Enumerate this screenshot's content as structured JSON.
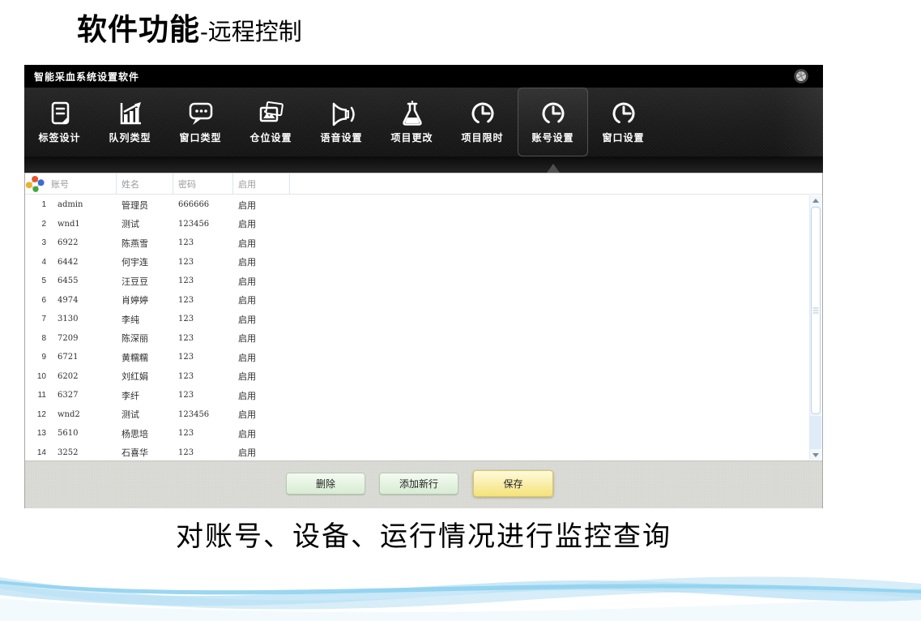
{
  "slide": {
    "title_main": "软件功能",
    "title_sub": "-远程控制",
    "caption": "对账号、设备、运行情况进行监控查询"
  },
  "window": {
    "title": "智能采血系统设置软件",
    "titlebar_icon": "shutter-gear-icon"
  },
  "toolbar": {
    "items": [
      {
        "id": "label-design",
        "label": "标签设计",
        "icon": "label-design-icon",
        "selected": false
      },
      {
        "id": "queue-type",
        "label": "队列类型",
        "icon": "queue-chart-icon",
        "selected": false
      },
      {
        "id": "window-type",
        "label": "窗口类型",
        "icon": "speech-bubble-icon",
        "selected": false
      },
      {
        "id": "bin-setting",
        "label": "仓位设置",
        "icon": "photos-icon",
        "selected": false
      },
      {
        "id": "voice-setting",
        "label": "语音设置",
        "icon": "speaker-icon",
        "selected": false
      },
      {
        "id": "project-change",
        "label": "项目更改",
        "icon": "flask-icon",
        "selected": false
      },
      {
        "id": "project-time-limit",
        "label": "项目限时",
        "icon": "clock-icon",
        "selected": false
      },
      {
        "id": "account-setting",
        "label": "账号设置",
        "icon": "clock-icon",
        "selected": true
      },
      {
        "id": "window-setting",
        "label": "窗口设置",
        "icon": "clock-icon",
        "selected": false
      }
    ]
  },
  "table": {
    "corner_icon": "molecule-users-icon",
    "columns": [
      "账号",
      "姓名",
      "密码",
      "启用"
    ],
    "rows": [
      {
        "num": "1",
        "account": "admin",
        "name": "管理员",
        "password": "666666",
        "enabled": "启用"
      },
      {
        "num": "2",
        "account": "wnd1",
        "name": "测试",
        "password": "123456",
        "enabled": "启用"
      },
      {
        "num": "3",
        "account": "6922",
        "name": "陈燕雪",
        "password": "123",
        "enabled": "启用"
      },
      {
        "num": "4",
        "account": "6442",
        "name": "何宇连",
        "password": "123",
        "enabled": "启用"
      },
      {
        "num": "5",
        "account": "6455",
        "name": "汪豆豆",
        "password": "123",
        "enabled": "启用"
      },
      {
        "num": "6",
        "account": "4974",
        "name": "肖婷婷",
        "password": "123",
        "enabled": "启用"
      },
      {
        "num": "7",
        "account": "3130",
        "name": "李纯",
        "password": "123",
        "enabled": "启用"
      },
      {
        "num": "8",
        "account": "7209",
        "name": "陈深丽",
        "password": "123",
        "enabled": "启用"
      },
      {
        "num": "9",
        "account": "6721",
        "name": "黄糯糯",
        "password": "123",
        "enabled": "启用"
      },
      {
        "num": "10",
        "account": "6202",
        "name": "刘红娟",
        "password": "123",
        "enabled": "启用"
      },
      {
        "num": "11",
        "account": "6327",
        "name": "李纤",
        "password": "123",
        "enabled": "启用"
      },
      {
        "num": "12",
        "account": "wnd2",
        "name": "测试",
        "password": "123456",
        "enabled": "启用"
      },
      {
        "num": "13",
        "account": "5610",
        "name": "杨思培",
        "password": "123",
        "enabled": "启用"
      },
      {
        "num": "14",
        "account": "3252",
        "name": "石喜华",
        "password": "123",
        "enabled": "启用"
      }
    ]
  },
  "buttons": {
    "delete": "删除",
    "add_row": "添加新行",
    "save": "保存"
  },
  "colors": {
    "titlebar_bg": "#000000",
    "toolbar_bg": "#1c1c1c",
    "selected_border": "#525252",
    "header_text": "#9b9b9b",
    "row_text": "#2e2e2e",
    "panel_bg": "#dcdcd7",
    "button_green": "#d8ecd2",
    "button_yellow": "#f5e279",
    "scrollbar_track": "#f1f7fc",
    "wave_blue": "#8fd2ef"
  }
}
